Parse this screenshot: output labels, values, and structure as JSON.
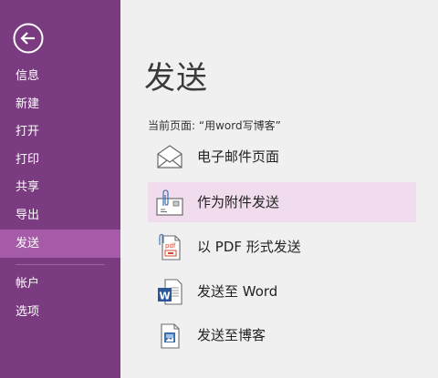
{
  "sidebar": {
    "back_label": "",
    "items": [
      {
        "label": "信息",
        "name": "info"
      },
      {
        "label": "新建",
        "name": "new"
      },
      {
        "label": "打开",
        "name": "open"
      },
      {
        "label": "打印",
        "name": "print"
      },
      {
        "label": "共享",
        "name": "share"
      },
      {
        "label": "导出",
        "name": "export"
      },
      {
        "label": "发送",
        "name": "send",
        "selected": true
      },
      {
        "label": "帐户",
        "name": "account"
      },
      {
        "label": "选项",
        "name": "options"
      }
    ]
  },
  "main": {
    "title": "发送",
    "current_page": "当前页面: “用word写博客”",
    "options": [
      {
        "label": "电子邮件页面",
        "icon": "envelope-icon"
      },
      {
        "label": "作为附件发送",
        "icon": "attachment-envelope-icon",
        "selected": true
      },
      {
        "label": "以 PDF 形式发送",
        "icon": "pdf-icon"
      },
      {
        "label": "发送至 Word",
        "icon": "word-document-icon"
      },
      {
        "label": "发送至博客",
        "icon": "blog-document-icon"
      }
    ]
  },
  "colors": {
    "sidebar_bg": "#7b3b81",
    "sidebar_selected": "#a55ba7",
    "option_selected": "#f0dcec",
    "main_bg": "#f0f0f0"
  }
}
